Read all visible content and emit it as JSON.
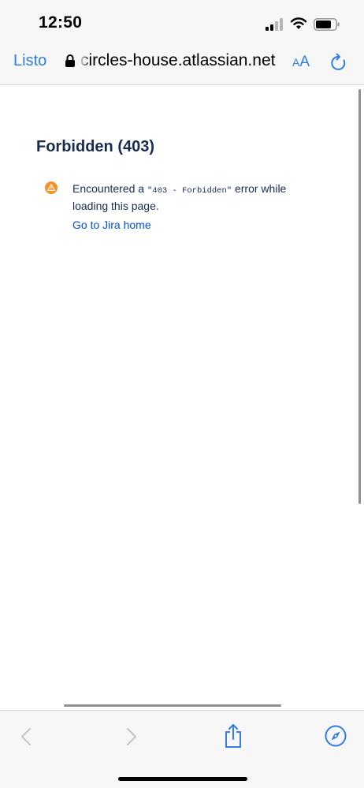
{
  "status_bar": {
    "time": "12:50"
  },
  "browser": {
    "done_label": "Listo",
    "url": "circles-house.atlassian.net",
    "text_size_small": "A",
    "text_size_large": "A"
  },
  "page": {
    "title": "Forbidden (403)",
    "message_prefix": "Encountered a ",
    "error_code": "\"403 - Forbidden\"",
    "message_suffix": " error while loading this page.",
    "home_link": "Go to Jira home"
  },
  "colors": {
    "accent": "#2f7ee0",
    "link": "#0052cc",
    "warning": "#f5932b",
    "title": "#172b4d"
  },
  "icons": {
    "signal": "cellular-signal-icon",
    "wifi": "wifi-icon",
    "battery": "battery-icon",
    "lock": "lock-icon",
    "reload": "reload-icon",
    "warning": "warning-icon",
    "back": "back-chevron-icon",
    "forward": "forward-chevron-icon",
    "share": "share-icon",
    "safari": "compass-icon"
  }
}
